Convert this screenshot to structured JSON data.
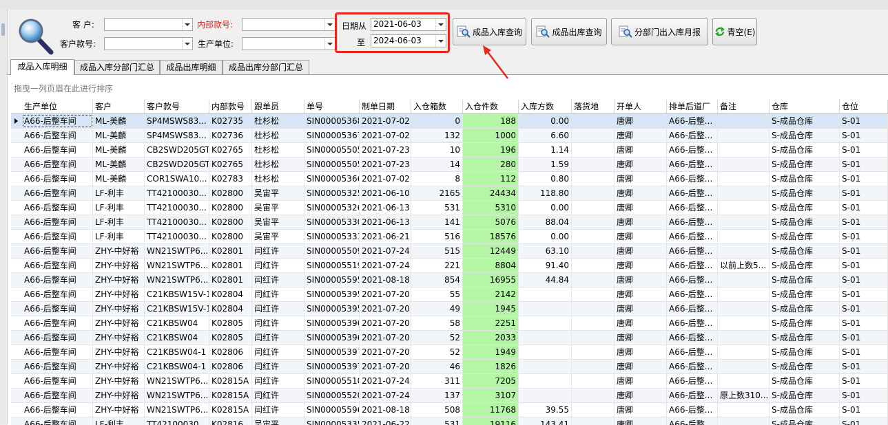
{
  "filters": {
    "customer_label": "客 户:",
    "internal_no_label": "内部款号:",
    "customer_no_label": "客户款号:",
    "prod_unit_label": "生产单位:",
    "customer_value": "",
    "internal_no_value": "",
    "customer_no_value": "",
    "prod_unit_value": "",
    "date_from_label": "日期从",
    "date_to_label": "至",
    "date_from": "2021-06-03",
    "date_to": "2024-06-03"
  },
  "buttons": {
    "in_query": "成品入库查询",
    "out_query": "成品出库查询",
    "dept_monthly": "分部门出入库月报",
    "clear": "青空(E)"
  },
  "tabs": [
    "成品入库明细",
    "成品入库分部门汇总",
    "成品出库明细",
    "成品出库分部门汇总"
  ],
  "group_hint": "拖曳一列页眉在此进行排序",
  "colors": {
    "highlight_box": "#e8271f",
    "green_cell": "#b4f5a6",
    "selected_row": "#d7e6f6"
  },
  "table": {
    "headers": [
      "生产单位",
      "客户",
      "客户款号",
      "内部款号",
      "跟单员",
      "单号",
      "制单日期",
      "入仓箱数",
      "入仓件数",
      "入库方数",
      "落货地",
      "开单人",
      "排单后道厂",
      "备注",
      "仓库",
      "仓位"
    ],
    "rows": [
      [
        "A66-后整车间",
        "ML-美麟",
        "SP4MSWS83...",
        "K02735",
        "杜杉松",
        "SIN00005368",
        "2021-07-02",
        "0",
        "188",
        "0.00",
        "",
        "唐卿",
        "A66-后整...",
        "",
        "S-成品仓库",
        "S-01"
      ],
      [
        "A66-后整车间",
        "ML-美麟",
        "SP4MSWS83...",
        "K02736",
        "杜杉松",
        "SIN00005367",
        "2021-07-02",
        "132",
        "1000",
        "6.60",
        "",
        "唐卿",
        "A66-后整...",
        "",
        "S-成品仓库",
        "S-01"
      ],
      [
        "A66-后整车间",
        "ML-美麟",
        "CB2SWD205GT",
        "K02765",
        "杜杉松",
        "SIN00005505",
        "2021-07-23",
        "10",
        "196",
        "1.14",
        "",
        "唐卿",
        "A66-后整...",
        "",
        "S-成品仓库",
        "S-01"
      ],
      [
        "A66-后整车间",
        "ML-美麟",
        "CB2SWD205GT",
        "K02765",
        "杜杉松",
        "SIN00005505",
        "2021-07-23",
        "14",
        "280",
        "1.59",
        "",
        "唐卿",
        "A66-后整...",
        "",
        "S-成品仓库",
        "S-01"
      ],
      [
        "A66-后整车间",
        "ML-美麟",
        "COR1SWA10...",
        "K02783",
        "杜杉松",
        "SIN00005366",
        "2021-07-02",
        "8",
        "112",
        "0.80",
        "",
        "唐卿",
        "A66-后整...",
        "",
        "S-成品仓库",
        "S-01"
      ],
      [
        "A66-后整车间",
        "LF-利丰",
        "TT42100030...",
        "K02800",
        "吴宙平",
        "SIN00005325",
        "2021-06-10",
        "2165",
        "24434",
        "118.80",
        "",
        "唐卿",
        "A66-后整...",
        "",
        "S-成品仓库",
        "S-01"
      ],
      [
        "A66-后整车间",
        "LF-利丰",
        "TT42100030...",
        "K02800",
        "吴宙平",
        "SIN00005326",
        "2021-06-13",
        "531",
        "5310",
        "0.00",
        "",
        "唐卿",
        "A66-后整...",
        "",
        "S-成品仓库",
        "S-01"
      ],
      [
        "A66-后整车间",
        "LF-利丰",
        "TT42100030...",
        "K02800",
        "吴宙平",
        "SIN00005330",
        "2021-06-13",
        "141",
        "5076",
        "88.04",
        "",
        "唐卿",
        "A66-后整...",
        "",
        "S-成品仓库",
        "S-01"
      ],
      [
        "A66-后整车间",
        "LF-利丰",
        "TT42100030...",
        "K02800",
        "吴宙平",
        "SIN00005333",
        "2021-06-21",
        "516",
        "18576",
        "0.00",
        "",
        "唐卿",
        "A66-后整...",
        "",
        "S-成品仓库",
        "S-01"
      ],
      [
        "A66-后整车间",
        "ZHY-中好裕",
        "WN21SWTP6...",
        "K02801",
        "闫红许",
        "SIN00005509",
        "2021-07-24",
        "515",
        "12449",
        "63.10",
        "",
        "唐卿",
        "A66-后整...",
        "",
        "S-成品仓库",
        "S-01"
      ],
      [
        "A66-后整车间",
        "ZHY-中好裕",
        "WN21SWTP6...",
        "K02801",
        "闫红许",
        "SIN00005519",
        "2021-07-24",
        "221",
        "8804",
        "91.40",
        "",
        "唐卿",
        "A66-后整...",
        "以前上数5...",
        "S-成品仓库",
        "S-01"
      ],
      [
        "A66-后整车间",
        "ZHY-中好裕",
        "WN21SWTP6...",
        "K02801",
        "闫红许",
        "SIN00005595",
        "2021-08-18",
        "854",
        "16955",
        "44.84",
        "",
        "唐卿",
        "A66-后整...",
        "",
        "S-成品仓库",
        "S-01"
      ],
      [
        "A66-后整车间",
        "ZHY-中好裕",
        "C21KBSW15V-1",
        "K02804",
        "闫红许",
        "SIN00005395",
        "2021-07-20",
        "55",
        "2142",
        "",
        "",
        "唐卿",
        "A66-后整...",
        "",
        "S-成品仓库",
        "S-01"
      ],
      [
        "A66-后整车间",
        "ZHY-中好裕",
        "C21KBSW15V-1",
        "K02804",
        "闫红许",
        "SIN00005395",
        "2021-07-20",
        "49",
        "1945",
        "",
        "",
        "唐卿",
        "A66-后整...",
        "",
        "S-成品仓库",
        "S-01"
      ],
      [
        "A66-后整车间",
        "ZHY-中好裕",
        "C21KBSW04",
        "K02805",
        "闫红许",
        "SIN00005396",
        "2021-07-20",
        "58",
        "2251",
        "",
        "",
        "唐卿",
        "A66-后整...",
        "",
        "S-成品仓库",
        "S-01"
      ],
      [
        "A66-后整车间",
        "ZHY-中好裕",
        "C21KBSW04",
        "K02805",
        "闫红许",
        "SIN00005396",
        "2021-07-20",
        "52",
        "2033",
        "",
        "",
        "唐卿",
        "A66-后整...",
        "",
        "S-成品仓库",
        "S-01"
      ],
      [
        "A66-后整车间",
        "ZHY-中好裕",
        "C21KBSW04-1",
        "K02806",
        "闫红许",
        "SIN00005397",
        "2021-07-20",
        "52",
        "1949",
        "",
        "",
        "唐卿",
        "A66-后整...",
        "",
        "S-成品仓库",
        "S-01"
      ],
      [
        "A66-后整车间",
        "ZHY-中好裕",
        "C21KBSW04-1",
        "K02806",
        "闫红许",
        "SIN00005397",
        "2021-07-20",
        "46",
        "1826",
        "",
        "",
        "唐卿",
        "A66-后整...",
        "",
        "S-成品仓库",
        "S-01"
      ],
      [
        "A66-后整车间",
        "ZHY-中好裕",
        "WN21SWTP6...",
        "K02815A",
        "闫红许",
        "SIN00005510",
        "2021-07-24",
        "311",
        "7205",
        "",
        "",
        "唐卿",
        "A66-后整...",
        "",
        "S-成品仓库",
        "S-01"
      ],
      [
        "A66-后整车间",
        "ZHY-中好裕",
        "WN21SWTP6...",
        "K02815A",
        "闫红许",
        "SIN00005520",
        "2021-07-24",
        "137",
        "3107",
        "",
        "",
        "唐卿",
        "A66-后整...",
        "原上数310...",
        "S-成品仓库",
        "S-01"
      ],
      [
        "A66-后整车间",
        "ZHY-中好裕",
        "WN21SWTP6...",
        "K02815A",
        "闫红许",
        "SIN00005596",
        "2021-08-18",
        "508",
        "11768",
        "39.55",
        "",
        "唐卿",
        "A66-后整...",
        "",
        "S-成品仓库",
        "S-01"
      ],
      [
        "A66-后整车间",
        "LF-利丰",
        "TT42100030...",
        "K02816",
        "吴宙平",
        "SIN00005335",
        "2021-06-22",
        "531",
        "19116",
        "143.41",
        "",
        "唐卿",
        "A66-后整...",
        "",
        "S-成品仓库",
        "S-01"
      ]
    ]
  }
}
